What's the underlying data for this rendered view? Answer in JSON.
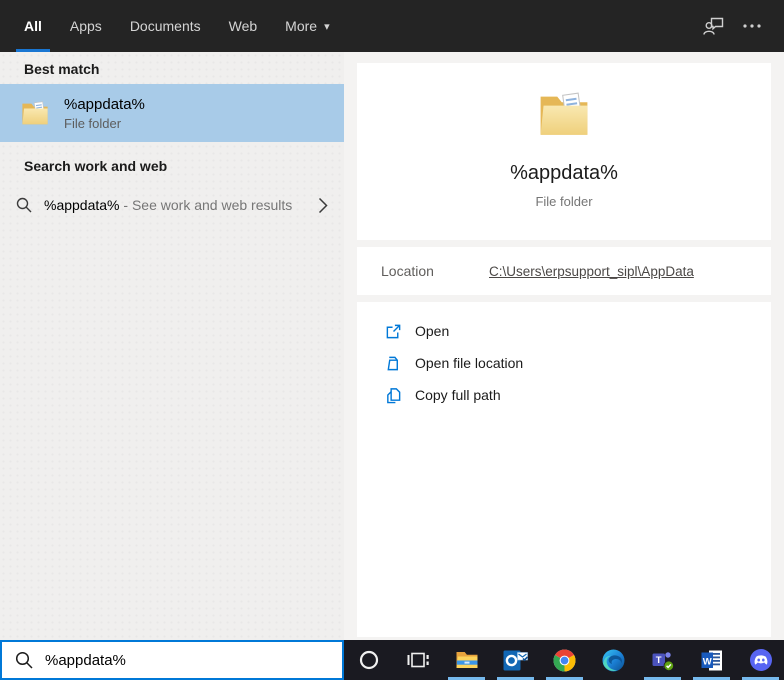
{
  "topbar": {
    "tabs": [
      {
        "label": "All",
        "active": true
      },
      {
        "label": "Apps",
        "active": false
      },
      {
        "label": "Documents",
        "active": false
      },
      {
        "label": "Web",
        "active": false
      },
      {
        "label": "More",
        "active": false
      }
    ],
    "more_caret": "▾",
    "icons": [
      "feedback-icon",
      "more-options-icon"
    ]
  },
  "left": {
    "best_match_header": "Best match",
    "best_match": {
      "title": "%appdata%",
      "subtitle": "File folder",
      "icon": "folder-icon"
    },
    "web_header": "Search work and web",
    "suggestion": {
      "query": "%appdata%",
      "suffix": " - See work and web results",
      "icon": "search-icon",
      "chevron": "chevron-right-icon"
    }
  },
  "right": {
    "preview": {
      "title": "%appdata%",
      "subtitle": "File folder",
      "icon": "folder-icon"
    },
    "location": {
      "label": "Location",
      "value": "C:\\Users\\erpsupport_sipl\\AppData"
    },
    "actions": [
      {
        "label": "Open",
        "icon": "open-icon"
      },
      {
        "label": "Open file location",
        "icon": "open-file-location-icon"
      },
      {
        "label": "Copy full path",
        "icon": "copy-icon"
      }
    ]
  },
  "search": {
    "value": "%appdata%",
    "icon": "search-icon"
  },
  "taskbar": {
    "items": [
      {
        "name": "cortana",
        "running": false
      },
      {
        "name": "task-view",
        "running": false
      },
      {
        "name": "file-explorer",
        "running": true
      },
      {
        "name": "outlook",
        "running": true
      },
      {
        "name": "chrome",
        "running": true
      },
      {
        "name": "edge",
        "running": false
      },
      {
        "name": "teams",
        "running": true
      },
      {
        "name": "word",
        "running": true
      },
      {
        "name": "discord",
        "running": true
      }
    ],
    "running_indicator_color": "#76b9ed"
  },
  "colors": {
    "accent": "#0078d7",
    "tab_underline": "#1976d2",
    "best_match_highlight": "#a8cbe8",
    "topbar_bg": "#242424",
    "taskbar_bg": "#1a1a21",
    "action_icon_blue": "#0078d7"
  }
}
